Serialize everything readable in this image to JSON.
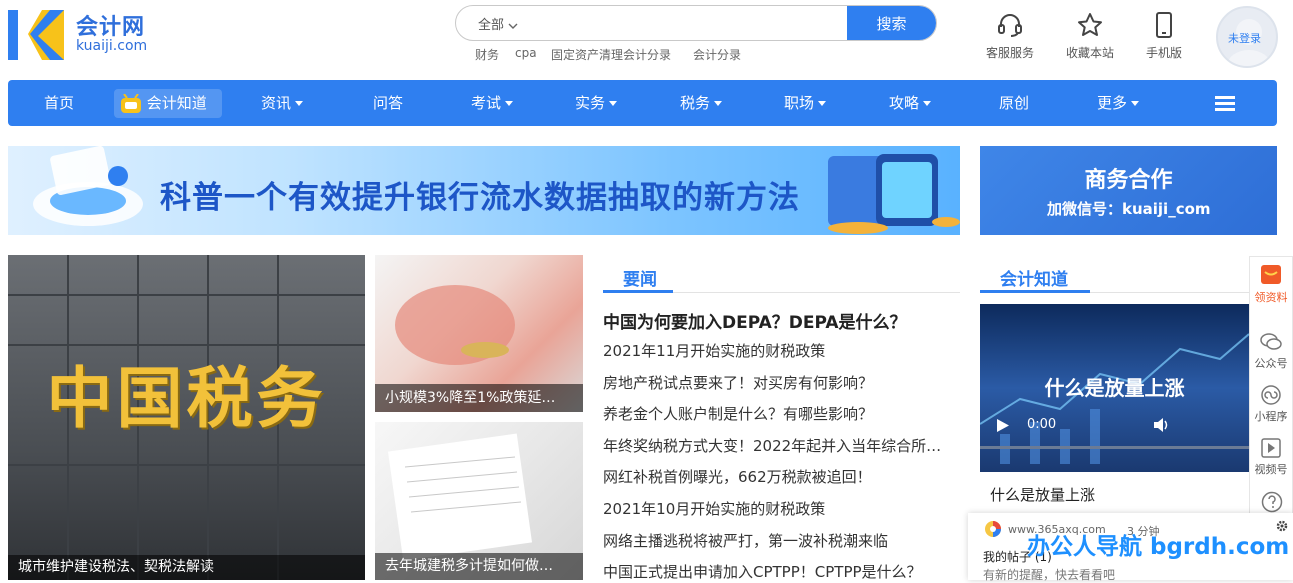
{
  "header": {
    "logo_cn": "会计网",
    "logo_en": "kuaiji.com",
    "search": {
      "scope": "全部",
      "placeholder": "",
      "button": "搜索",
      "hot": [
        "财务",
        "cpa",
        "固定资产清理会计分录",
        "会计分录"
      ]
    },
    "tools": [
      "客服服务",
      "收藏本站",
      "手机版"
    ],
    "avatar_label": "未登录"
  },
  "nav": {
    "items": [
      "首页",
      "会计知道",
      "资讯",
      "问答",
      "考试",
      "实务",
      "税务",
      "职场",
      "攻略",
      "原创",
      "更多"
    ],
    "dropdown": [
      false,
      false,
      true,
      false,
      true,
      true,
      true,
      true,
      true,
      false,
      true
    ]
  },
  "banners": {
    "main_text": "科普一个有效提升银行流水数据抽取的新方法",
    "side_title": "商务合作",
    "side_sub": "加微信号：kuaiji_com"
  },
  "features": {
    "main_caption": "城市维护建设税法、契税法解读",
    "main_sign": "中国税务",
    "a_caption": "小规模3%降至1%政策延…",
    "b_caption": "去年城建税多计提如何做…"
  },
  "news": {
    "title": "要闻",
    "items": [
      "中国为何要加入DEPA？DEPA是什么？",
      "2021年11月开始实施的财税政策",
      "房地产税试点要来了！对买房有何影响？",
      "养老金个人账户制是什么？有哪些影响？",
      "年终奖纳税方式大变！2022年起并入当年综合所…",
      "网红补税首例曝光，662万税款被追回！",
      "2021年10月开始实施的财税政策",
      "网络主播逃税将被严打，第一波补税潮来临",
      "中国正式提出申请加入CPTPP！CPTPP是什么？"
    ]
  },
  "zhidao": {
    "title": "会计知道",
    "video_title": "什么是放量上涨",
    "video_time": "0:00",
    "caption": "什么是放量上涨"
  },
  "float_bar": [
    "领资料",
    "公众号",
    "小程序",
    "视频号"
  ],
  "popup": {
    "source": "www.365axq.com",
    "time": "3 分钟",
    "title": "我的帖子 (1)",
    "sub": "有新的提醒，快去看看吧"
  },
  "watermark": "办公人导航 bgrdh.com",
  "colors": {
    "brand": "#2f7ff0",
    "logo_yellow": "#f7c21a"
  }
}
